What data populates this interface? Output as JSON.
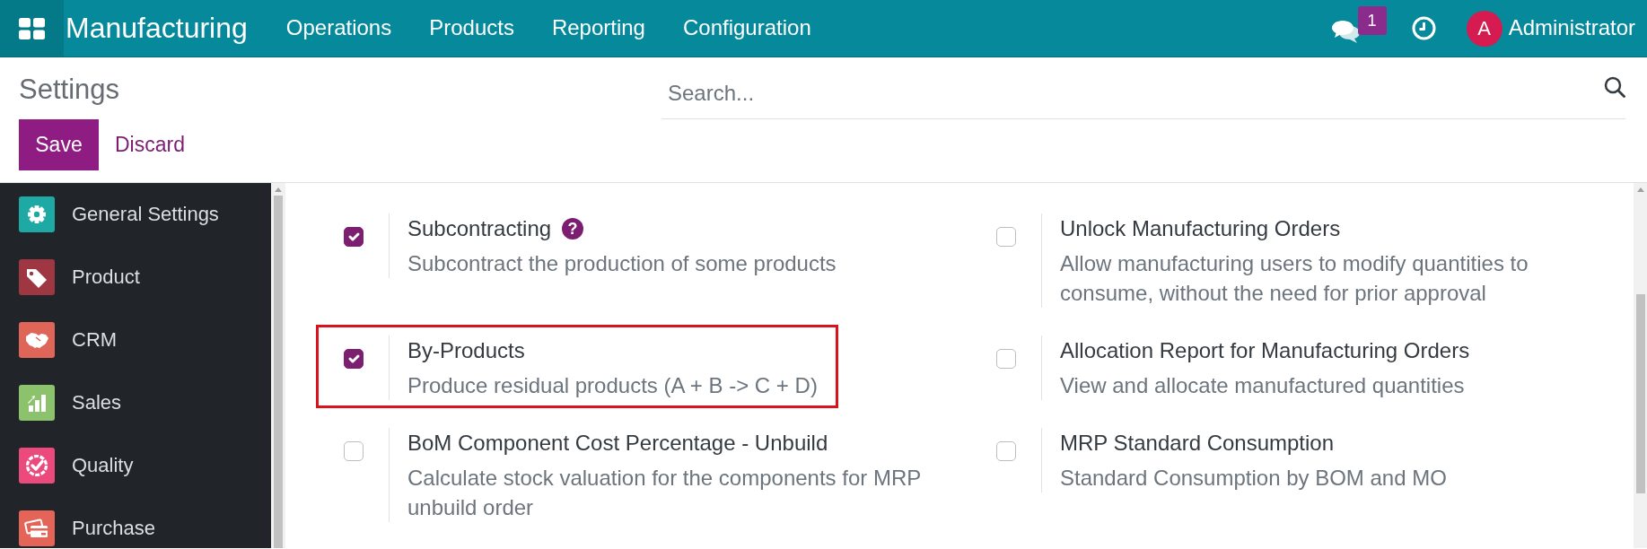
{
  "navbar": {
    "app_title": "Manufacturing",
    "menu": [
      "Operations",
      "Products",
      "Reporting",
      "Configuration"
    ],
    "message_count": "1",
    "avatar_letter": "A",
    "user_name": "Administrator"
  },
  "control_panel": {
    "title": "Settings",
    "save_label": "Save",
    "discard_label": "Discard",
    "search": {
      "placeholder": "Search..."
    }
  },
  "sidebar": {
    "items": [
      {
        "label": "General Settings",
        "color": "#1fa9a5"
      },
      {
        "label": "Product",
        "color": "#9e3741"
      },
      {
        "label": "CRM",
        "color": "#e06559"
      },
      {
        "label": "Sales",
        "color": "#8dc26d"
      },
      {
        "label": "Quality",
        "color": "#ec4a7c"
      },
      {
        "label": "Purchase",
        "color": "#e56458"
      }
    ]
  },
  "settings": [
    {
      "title": "Subcontracting",
      "help": "?",
      "description": "Subcontract the production of some products",
      "checked": true,
      "highlighted": false
    },
    {
      "title": "Unlock Manufacturing Orders",
      "description": "Allow manufacturing users to modify quantities to consume, without the need for prior approval",
      "checked": false,
      "highlighted": false
    },
    {
      "title": "By-Products",
      "description": "Produce residual products (A + B -> C + D)",
      "checked": true,
      "highlighted": true
    },
    {
      "title": "Allocation Report for Manufacturing Orders",
      "description": "View and allocate manufactured quantities",
      "checked": false,
      "highlighted": false
    },
    {
      "title": "BoM Component Cost Percentage - Unbuild",
      "description": "Calculate stock valuation for the components for MRP unbuild order",
      "checked": false,
      "highlighted": false
    },
    {
      "title": "MRP Standard Consumption",
      "description": "Standard Consumption by BOM and MO",
      "checked": false,
      "highlighted": false
    }
  ]
}
